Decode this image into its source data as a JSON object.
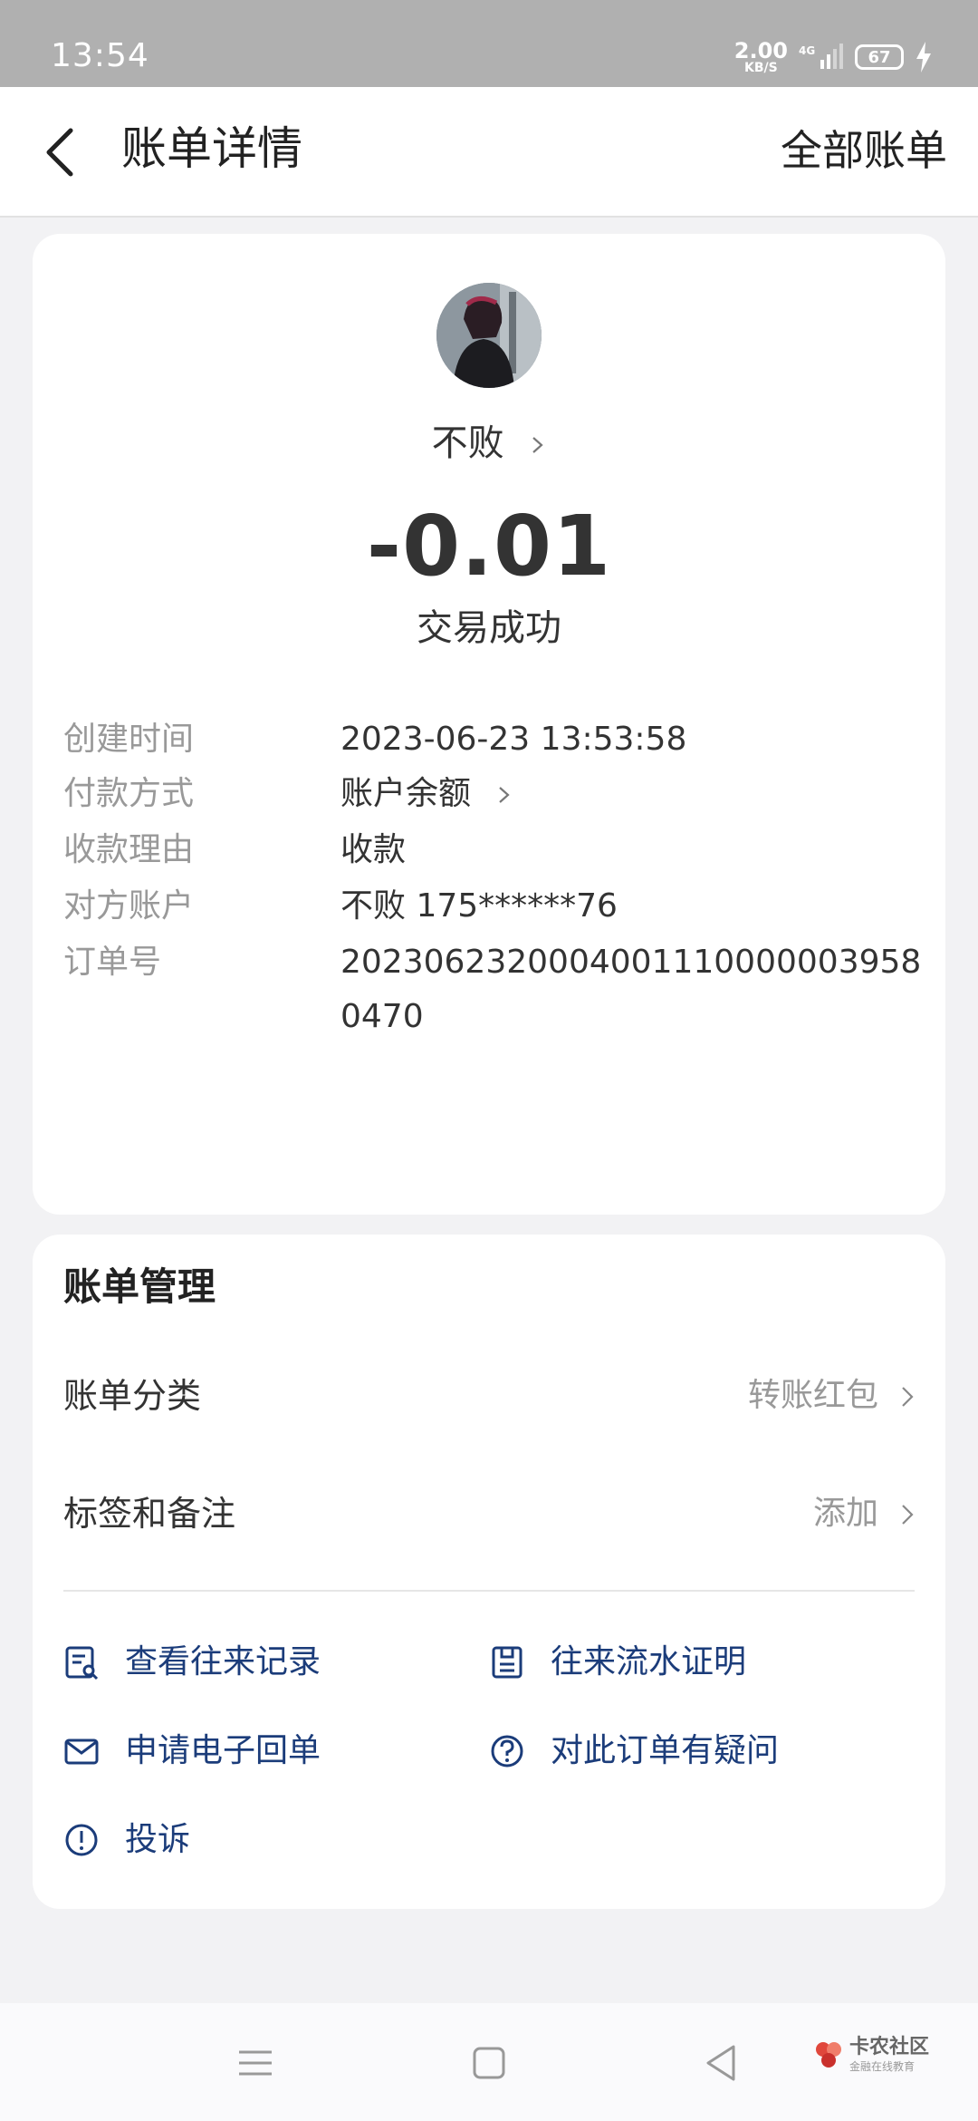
{
  "status_bar": {
    "time": "13:54",
    "net_speed": "2.00",
    "net_unit": "KB/S",
    "network": "4G",
    "battery": "67"
  },
  "nav": {
    "title": "账单详情",
    "right": "全部账单"
  },
  "bill": {
    "payee": "不败",
    "amount": "-0.01",
    "status": "交易成功",
    "rows": [
      {
        "label": "创建时间",
        "value": "2023-06-23 13:53:58"
      },
      {
        "label": "付款方式",
        "value": "账户余额"
      },
      {
        "label": "收款理由",
        "value": "收款"
      },
      {
        "label": "对方账户",
        "value": "不败 175******76"
      },
      {
        "label": "订单号",
        "value": "20230623200040011100000039580470"
      }
    ]
  },
  "management": {
    "title": "账单管理",
    "category_label": "账单分类",
    "category_value": "转账红包",
    "tag_label": "标签和备注",
    "tag_value": "添加",
    "links": {
      "history": "查看往来记录",
      "proof": "往来流水证明",
      "receipt": "申请电子回单",
      "question": "对此订单有疑问",
      "complain": "投诉"
    }
  },
  "watermark": {
    "brand": "卡农社区",
    "tagline": "金融在线教育"
  },
  "colors": {
    "link": "#1b3c7a",
    "label_gray": "#999999",
    "background": "#f2f2f4"
  }
}
